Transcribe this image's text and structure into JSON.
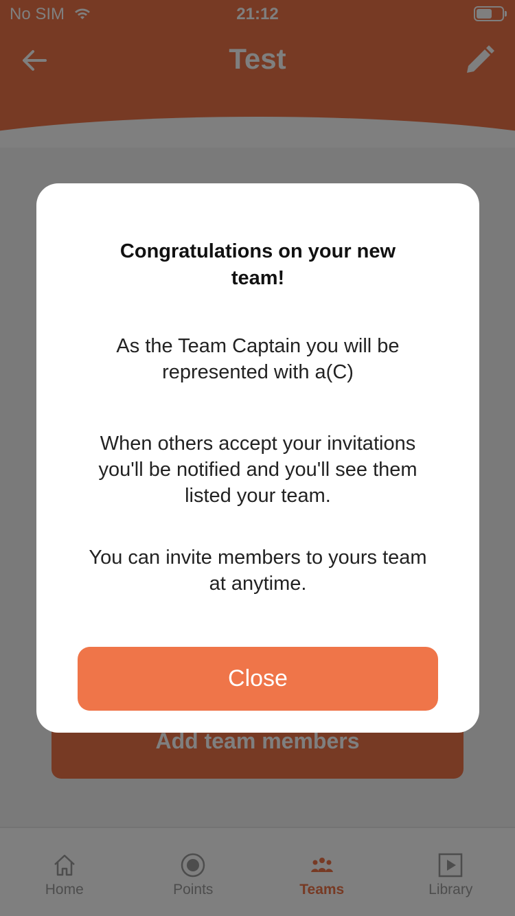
{
  "status_bar": {
    "carrier": "No SIM",
    "time": "21:12"
  },
  "header": {
    "title": "Test",
    "back_icon": "arrow-left-icon",
    "edit_icon": "pencil-icon"
  },
  "main": {
    "add_members_label": "Add team members"
  },
  "modal": {
    "title": "Congratulations on your new team!",
    "paragraphs": [
      "As the Team Captain you will be represented with a(C)",
      "When others accept your invitations you'll be notified and you'll see them listed your team.",
      "You can invite members to yours team at anytime."
    ],
    "close_label": "Close"
  },
  "tab_bar": {
    "items": [
      {
        "label": "Home",
        "icon": "home-icon",
        "active": false
      },
      {
        "label": "Points",
        "icon": "target-icon",
        "active": false
      },
      {
        "label": "Teams",
        "icon": "team-icon",
        "active": true
      },
      {
        "label": "Library",
        "icon": "play-icon",
        "active": false
      }
    ]
  },
  "colors": {
    "accent": "#ef7549",
    "background": "#f4f4f4",
    "overlay": "rgba(0,0,0,0.5)"
  }
}
